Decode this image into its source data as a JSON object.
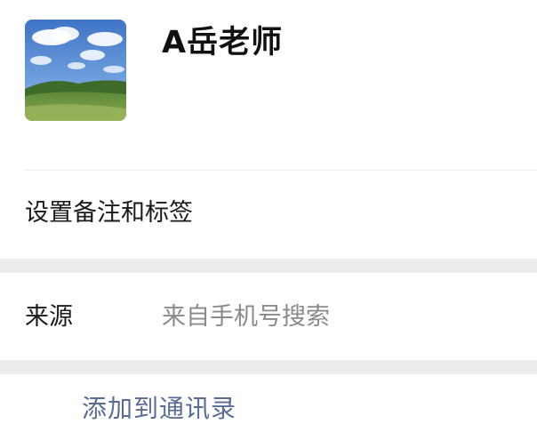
{
  "profile": {
    "name": "A岳老师",
    "avatar_icon": "landscape-avatar-image"
  },
  "rows": {
    "remark_label": "设置备注和标签",
    "source_label": "来源",
    "source_value": "来自手机号搜索"
  },
  "actions": {
    "add_to_contacts": "添加到通讯录"
  },
  "colors": {
    "link_blue": "#576b95",
    "separator_gray": "#ededed",
    "secondary_text": "#8a8a8a"
  }
}
